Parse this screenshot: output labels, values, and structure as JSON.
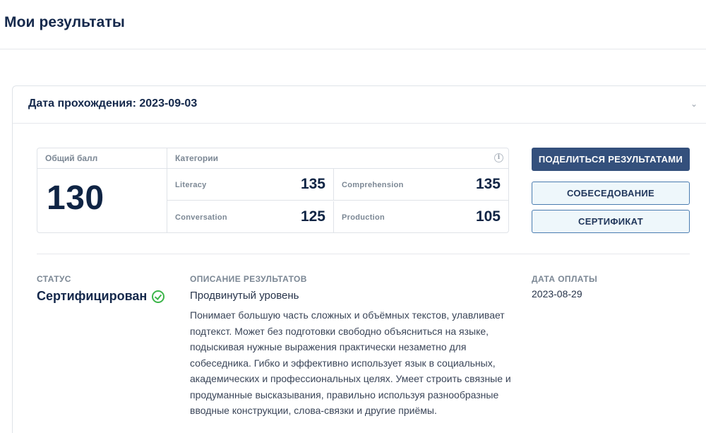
{
  "page": {
    "title": "Мои результаты"
  },
  "card": {
    "head_label": "Дата прохождения:",
    "head_date": "2023-09-03",
    "collapse_icon": "chevron-down-icon"
  },
  "scores": {
    "total_label": "Общий балл",
    "total_value": "130",
    "categories_label": "Категории",
    "categories": [
      {
        "name": "Literacy",
        "value": "135"
      },
      {
        "name": "Comprehension",
        "value": "135"
      },
      {
        "name": "Conversation",
        "value": "125"
      },
      {
        "name": "Production",
        "value": "105"
      }
    ]
  },
  "buttons": {
    "share": "ПОДЕЛИТЬСЯ РЕЗУЛЬТАТАМИ",
    "interview": "СОБЕСЕДОВАНИЕ",
    "certificate": "СЕРТИФИКАТ"
  },
  "status": {
    "label": "СТАТУС",
    "value": "Сертифицирован"
  },
  "description": {
    "label": "ОПИСАНИЕ РЕЗУЛЬТАТОВ",
    "level": "Продвинутый уровень",
    "text": "Понимает большую часть сложных и объёмных текстов, улавливает подтекст. Может без подготовки свободно объясниться на языке, подыскивая нужные выражения практически незаметно для собеседника. Гибко и эффективно использует язык в социальных, академических и профессиональных целях. Умеет строить связные и продуманные высказывания, правильно используя разнообразные вводные конструкции, слова-связки и другие приёмы."
  },
  "payment": {
    "label": "ДАТА ОПЛАТЫ",
    "date": "2023-08-29"
  },
  "colors": {
    "primary": "#34507c",
    "title": "#14284b",
    "success": "#3cb54a"
  }
}
